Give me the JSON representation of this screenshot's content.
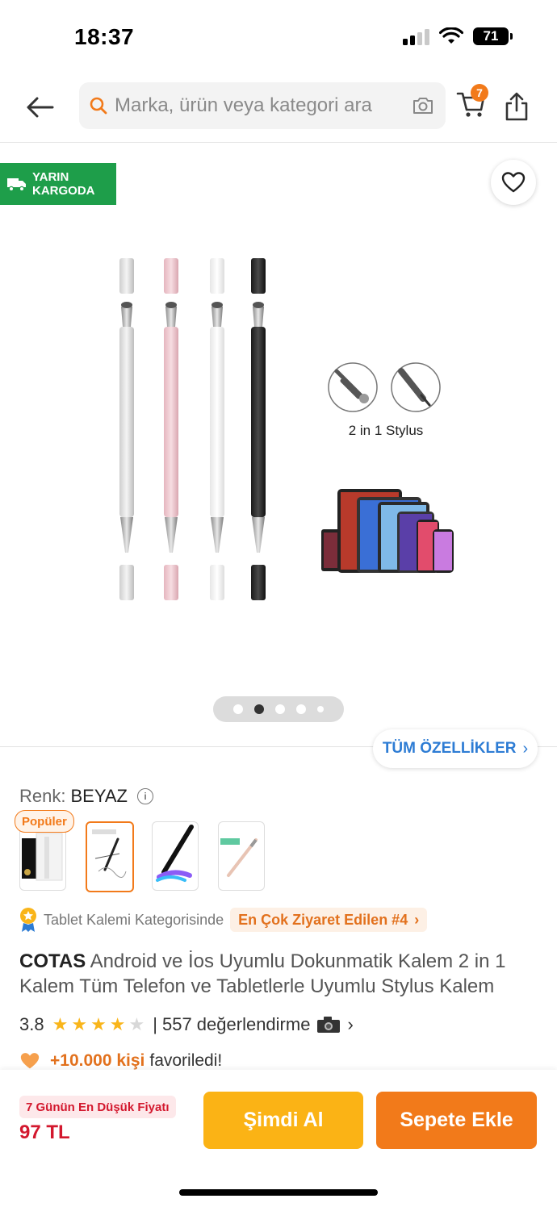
{
  "status_bar": {
    "time": "18:37",
    "battery": "71"
  },
  "search": {
    "placeholder": "Marka, ürün veya kategori ara"
  },
  "cart": {
    "count": "7"
  },
  "gallery": {
    "delivery_line1": "YARIN",
    "delivery_line2": "KARGODA",
    "stylus_caption": "2 in 1 Stylus",
    "all_features_label": "TÜM ÖZELLİKLER",
    "image_count": 5,
    "active_index": 1
  },
  "variant": {
    "label": "Renk:",
    "value": "BEYAZ",
    "popular_tag": "Popüler"
  },
  "ranking": {
    "category_text": "Tablet Kalemi Kategorisinde",
    "rank_text": "En Çok Ziyaret Edilen #4"
  },
  "product": {
    "brand": "COTAS",
    "title": "Android ve İos Uyumlu Dokunmatik Kalem 2 in 1 Kalem Tüm Telefon ve Tabletlerle Uyumlu Stylus Kalem"
  },
  "rating": {
    "score": "3.8",
    "stars_value": 3.8,
    "stars_max": 5,
    "separator": "|",
    "reviews_text": "557 değerlendirme"
  },
  "favorites": {
    "count_text": "+10.000 kişi",
    "label": "favoriledi!"
  },
  "bottom_bar": {
    "lowest_price_badge": "7 Günün En Düşük Fiyatı",
    "price": "97 TL",
    "buy_now_label": "Şimdi Al",
    "add_to_cart_label": "Sepete Ekle"
  },
  "colors": {
    "accent_orange": "#f27a1a",
    "buy_now_yellow": "#fbb315",
    "delivery_green": "#1e9e4a",
    "link_blue": "#2d7cd4",
    "price_red": "#d3182e"
  }
}
